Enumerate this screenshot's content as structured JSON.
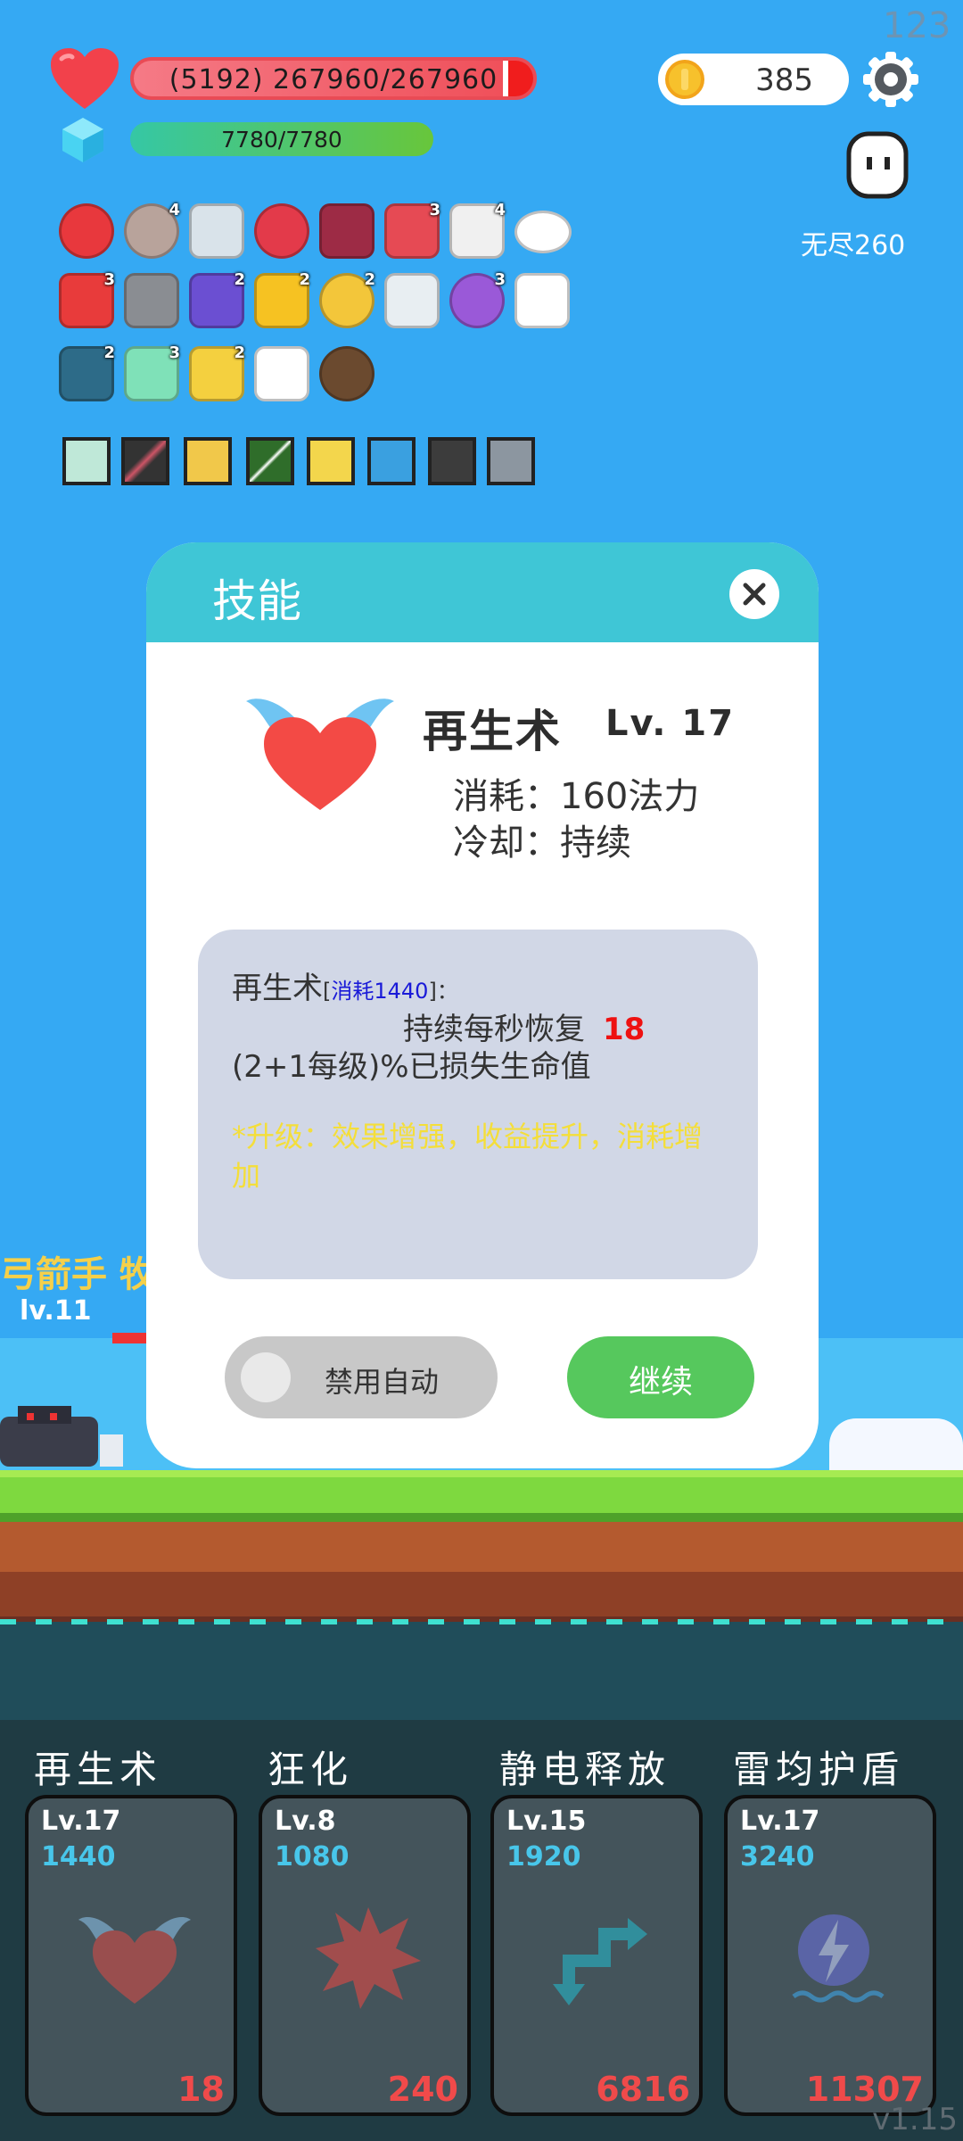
{
  "corner": {
    "fps": "123",
    "version": "v1.15"
  },
  "hud": {
    "hp_text": "(5192) 267960/267960",
    "mp_text": "7780/7780",
    "coins": "385",
    "mode_label": "无尽260"
  },
  "items_row1": [
    "apple-icon",
    "shield-icon",
    "sword-icon",
    "strawberry-icon",
    "jam-jar-icon",
    "watermelon-icon",
    "pill-icon",
    "eye-icon"
  ],
  "items_row2": [
    "heart-pair-icon",
    "knight-helmet-icon",
    "chest-icon",
    "sunflower-icon",
    "ring-icon",
    "lightbulb-icon",
    "crystal-ball-icon",
    "ghost-icon"
  ],
  "items_row3": [
    "fish-icon",
    "alien-icon",
    "magic-wand-icon",
    "envelope-icon",
    "coconut-icon"
  ],
  "item_badges": {
    "shield": "4",
    "watermelon": "3",
    "pill": "4",
    "heart_pair": "3",
    "chest": "2",
    "sunflower": "2",
    "ring": "2",
    "crystal_ball": "3",
    "fish": "2",
    "alien": "3",
    "wand": "2"
  },
  "modal": {
    "title": "技能",
    "skill_name": "再生术",
    "skill_level": "Lv. 17",
    "cost_line": "消耗：160法力",
    "cooldown_line": "冷却：持续",
    "desc_name": "再生术",
    "desc_cost_open": "[",
    "desc_cost_text": "消耗1440",
    "desc_cost_close": "]：",
    "desc_effect": "持续每秒恢复",
    "desc_effect_value": "18",
    "desc_formula": "(2+1每级)%已损失生命值",
    "desc_upgrade": "*升级：效果增强，收益提升，消耗增加",
    "toggle_label": "禁用自动",
    "continue_label": "继续"
  },
  "battle": {
    "float_text_1": "弓箭手 牧师",
    "float_text_2": "lv.11"
  },
  "skill_cards": [
    {
      "title": "再生术",
      "level": "Lv.17",
      "cost": "1440",
      "count": "18",
      "icon": "winged-heart-icon"
    },
    {
      "title": "狂化",
      "level": "Lv.8",
      "cost": "1080",
      "count": "240",
      "icon": "burst-icon"
    },
    {
      "title": "静电释放",
      "level": "Lv.15",
      "cost": "1920",
      "count": "6816",
      "icon": "arrows-icon"
    },
    {
      "title": "雷均护盾",
      "level": "Lv.17",
      "cost": "3240",
      "count": "11307",
      "icon": "lightning-shield-icon"
    }
  ],
  "colors": {
    "sky": "#35a9f3",
    "modal_header": "#3fc6d6",
    "continue": "#56c85d",
    "hp": "#ef4d57",
    "mp": "#68c63b"
  }
}
